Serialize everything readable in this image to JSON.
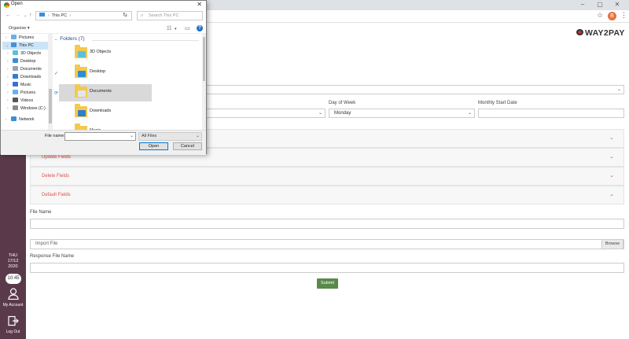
{
  "browser": {
    "window_controls": [
      "–",
      "▢",
      "✕"
    ],
    "star_icon": "star-icon",
    "profile_initial": "B"
  },
  "sidebar": {
    "day": "THU",
    "date": "17/12",
    "year": "2020",
    "time": "10:45",
    "my_account": "My Account",
    "log_out": "Log Out"
  },
  "brand": {
    "name": "WAY2PAY"
  },
  "form": {
    "day_of_week_label": "Day of Week",
    "day_of_week_value": "Monday",
    "monthly_start_label": "Monthly Start Date",
    "sections": [
      "Update Fields",
      "Delete Fields",
      "Default Fields"
    ],
    "file_name_label": "File Name",
    "import_placeholder": "Import File",
    "browse_label": "Browse",
    "response_label": "Response File Name",
    "submit_label": "Submit"
  },
  "dialog": {
    "title": "Open",
    "close": "✕",
    "path": "This PC",
    "search_placeholder": "Search This PC",
    "organise": "Organise ▾",
    "tree": [
      {
        "label": "Pictures",
        "arrow": "›",
        "color": "#6ab0e8"
      },
      {
        "label": "This PC",
        "arrow": "⌄",
        "color": "#4a90d9",
        "selected": true
      },
      {
        "label": "3D Objects",
        "arrow": "›",
        "color": "#5bc0de"
      },
      {
        "label": "Desktop",
        "arrow": "›",
        "color": "#3a8fd8"
      },
      {
        "label": "Documents",
        "arrow": "›",
        "color": "#9aa6b2"
      },
      {
        "label": "Downloads",
        "arrow": "›",
        "color": "#2f7fd1",
        "highlight": true
      },
      {
        "label": "Music",
        "arrow": "›",
        "color": "#3a6fd8"
      },
      {
        "label": "Pictures",
        "arrow": "›",
        "color": "#6ab0e8"
      },
      {
        "label": "Videos",
        "arrow": "›",
        "color": "#555555"
      },
      {
        "label": "Windows (C:)",
        "arrow": "›",
        "color": "#8a8a8a"
      },
      {
        "label": "Network",
        "arrow": "›",
        "color": "#3a8fd8"
      }
    ],
    "folders_header": "Folders (7)",
    "folders": [
      {
        "name": "3D Objects",
        "overlay": "#5bc0de"
      },
      {
        "name": "Desktop",
        "overlay": "#2a8fd8"
      },
      {
        "name": "Documents",
        "overlay": "#dfe6ee",
        "selected": true
      },
      {
        "name": "Downloads",
        "overlay": "#2f7fd1"
      },
      {
        "name": "Music",
        "overlay": "#3a6fd8"
      }
    ],
    "file_name_label": "File name:",
    "file_name_value": "",
    "file_type": "All Files",
    "open_label": "Open",
    "cancel_label": "Cancel"
  }
}
